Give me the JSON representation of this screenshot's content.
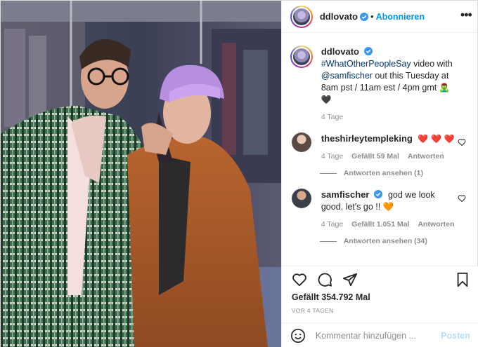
{
  "header": {
    "username": "ddlovato",
    "separator": "•",
    "follow_label": "Abonnieren",
    "more_icon": "more-options-icon"
  },
  "caption": {
    "username": "ddlovato",
    "hashtag": "#WhatOtherPeopleSay",
    "text_before_mention": " video with ",
    "mention": "@samfischer",
    "text_after_mention": " out this Tuesday at 8am pst / 11am est / 4pm gmt",
    "emojis": "🧟‍♂️ 🖤",
    "time": "4 Tage"
  },
  "comments": [
    {
      "username": "theshirleytempleking",
      "text": "❤️ ❤️ ❤️",
      "time": "4 Tage",
      "likes": "Gefällt 59 Mal",
      "reply_label": "Antworten",
      "view_replies": "Antworten ansehen (1)"
    },
    {
      "username": "samfischer",
      "text": "god we look good. let's go !! 🧡",
      "time": "4 Tage",
      "likes": "Gefällt 1.051 Mal",
      "reply_label": "Antworten",
      "view_replies": "Antworten ansehen (34)"
    }
  ],
  "actions": {
    "like_icon": "heart-icon",
    "comment_icon": "comment-icon",
    "share_icon": "share-icon",
    "save_icon": "bookmark-icon",
    "likes_text": "Gefällt 354.792 Mal",
    "date_text": "VOR 4 TAGEN"
  },
  "add_comment": {
    "placeholder": "Kommentar hinzufügen ...",
    "post_label": "Posten"
  },
  "colors": {
    "accent": "#0095f6",
    "muted": "#8e8e8e",
    "post_disabled": "#b2dffc",
    "like_red": "#ed4956"
  }
}
